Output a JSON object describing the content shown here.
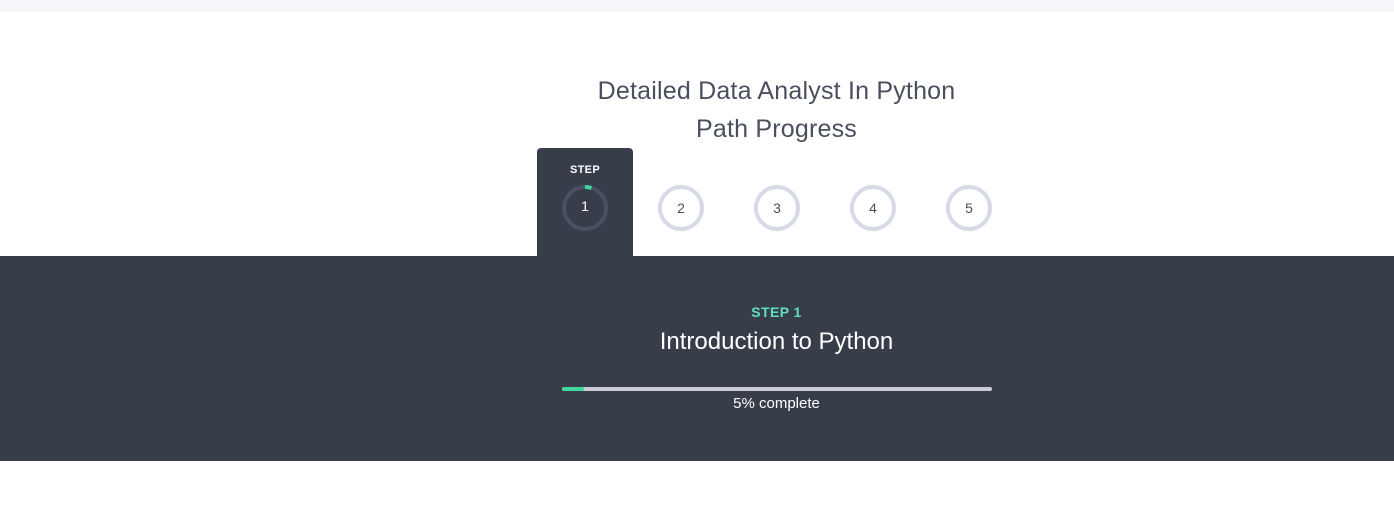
{
  "header": {
    "title_line1": "Detailed Data Analyst In Python",
    "title_line2": "Path Progress"
  },
  "stepper": {
    "active_label": "STEP",
    "active_number": "1",
    "steps": [
      "1",
      "2",
      "3",
      "4",
      "5"
    ]
  },
  "current_step": {
    "label": "STEP 1",
    "title": "Introduction to Python",
    "progress_percent": 5,
    "progress_text": "5% complete"
  },
  "colors": {
    "panel_bg": "#383d4a",
    "accent_teal": "#5ee0c0",
    "progress_fill": "#40d89a",
    "progress_track": "#c9cdd8",
    "ring_inactive": "#d5dae6"
  }
}
